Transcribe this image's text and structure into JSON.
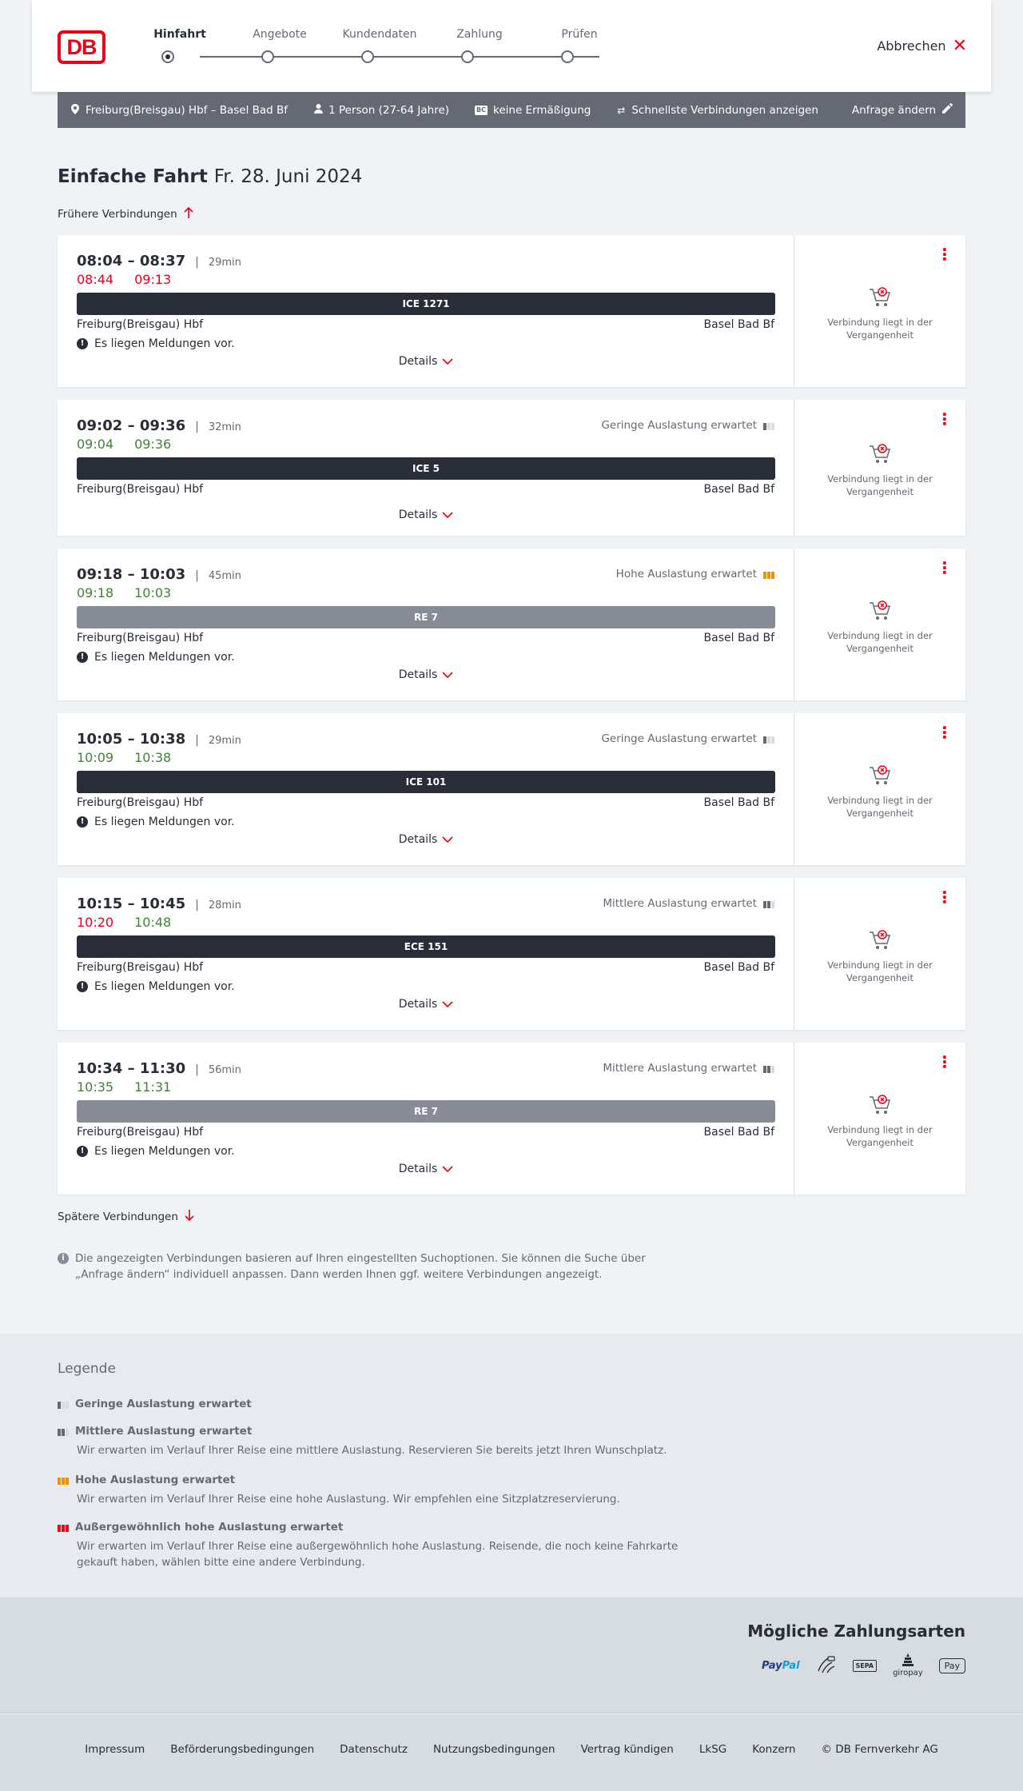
{
  "header": {
    "logo": "DB",
    "steps": [
      "Hinfahrt",
      "Angebote",
      "Kundendaten",
      "Zahlung",
      "Prüfen"
    ],
    "active_step": 0,
    "cancel_label": "Abbrechen"
  },
  "search": {
    "route": "Freiburg(Breisgau) Hbf – Basel Bad Bf",
    "passengers": "1 Person (27-64 Jahre)",
    "bahncard_badge": "BC",
    "discount": "keine Ermäßigung",
    "fastest": "Schnellste Verbindungen anzeigen",
    "change_label": "Anfrage ändern"
  },
  "page": {
    "title": "Einfache Fahrt",
    "date": "Fr. 28. Juni 2024",
    "earlier_label": "Frühere Verbindungen",
    "later_label": "Spätere Verbindungen",
    "info_text": "Die angezeigten Verbindungen basieren auf Ihren eingestellten Suchoptionen. Sie können die Suche über „Anfrage ändern“ individuell anpassen. Dann werden Ihnen ggf. weitere Verbindungen angezeigt."
  },
  "connections": [
    {
      "time": "08:04 – 08:37",
      "duration": "29min",
      "rt_dep": "08:44",
      "rt_arr": "09:13",
      "rt_dep_status": "late",
      "rt_arr_status": "late",
      "load_label": "",
      "load_level": 0,
      "train": "ICE 1271",
      "train_style": "dark",
      "from": "Freiburg(Breisgau) Hbf",
      "to": "Basel Bad Bf",
      "notice": "Es liegen Meldungen vor.",
      "details": "Details",
      "side_text": "Verbindung liegt in der Vergangenheit"
    },
    {
      "time": "09:02 – 09:36",
      "duration": "32min",
      "rt_dep": "09:04",
      "rt_arr": "09:36",
      "rt_dep_status": "ok",
      "rt_arr_status": "ok",
      "load_label": "Geringe Auslastung erwartet",
      "load_level": 1,
      "train": "ICE 5",
      "train_style": "dark",
      "from": "Freiburg(Breisgau) Hbf",
      "to": "Basel Bad Bf",
      "notice": "",
      "details": "Details",
      "side_text": "Verbindung liegt in der Vergangenheit"
    },
    {
      "time": "09:18 – 10:03",
      "duration": "45min",
      "rt_dep": "09:18",
      "rt_arr": "10:03",
      "rt_dep_status": "ok",
      "rt_arr_status": "ok",
      "load_label": "Hohe Auslastung erwartet",
      "load_level": 3,
      "train": "RE 7",
      "train_style": "grey",
      "from": "Freiburg(Breisgau) Hbf",
      "to": "Basel Bad Bf",
      "notice": "Es liegen Meldungen vor.",
      "details": "Details",
      "side_text": "Verbindung liegt in der Vergangenheit"
    },
    {
      "time": "10:05 – 10:38",
      "duration": "29min",
      "rt_dep": "10:09",
      "rt_arr": "10:38",
      "rt_dep_status": "ok",
      "rt_arr_status": "ok",
      "load_label": "Geringe Auslastung erwartet",
      "load_level": 1,
      "train": "ICE 101",
      "train_style": "dark",
      "from": "Freiburg(Breisgau) Hbf",
      "to": "Basel Bad Bf",
      "notice": "Es liegen Meldungen vor.",
      "details": "Details",
      "side_text": "Verbindung liegt in der Vergangenheit"
    },
    {
      "time": "10:15 – 10:45",
      "duration": "28min",
      "rt_dep": "10:20",
      "rt_arr": "10:48",
      "rt_dep_status": "late",
      "rt_arr_status": "ok",
      "load_label": "Mittlere Auslastung erwartet",
      "load_level": 2,
      "train": "ECE 151",
      "train_style": "dark",
      "from": "Freiburg(Breisgau) Hbf",
      "to": "Basel Bad Bf",
      "notice": "Es liegen Meldungen vor.",
      "details": "Details",
      "side_text": "Verbindung liegt in der Vergangenheit"
    },
    {
      "time": "10:34 – 11:30",
      "duration": "56min",
      "rt_dep": "10:35",
      "rt_arr": "11:31",
      "rt_dep_status": "ok",
      "rt_arr_status": "ok",
      "load_label": "Mittlere Auslastung erwartet",
      "load_level": 2,
      "train": "RE 7",
      "train_style": "grey",
      "from": "Freiburg(Breisgau) Hbf",
      "to": "Basel Bad Bf",
      "notice": "Es liegen Meldungen vor.",
      "details": "Details",
      "side_text": "Verbindung liegt in der Vergangenheit"
    }
  ],
  "legend": {
    "title": "Legende",
    "items": [
      {
        "level": 1,
        "title": "Geringe Auslastung erwartet",
        "desc": ""
      },
      {
        "level": 2,
        "title": "Mittlere Auslastung erwartet",
        "desc": "Wir erwarten im Verlauf Ihrer Reise eine mittlere Auslastung. Reservieren Sie bereits jetzt Ihren Wunschplatz."
      },
      {
        "level": 3,
        "title": "Hohe Auslastung erwartet",
        "desc": "Wir erwarten im Verlauf Ihrer Reise eine hohe Auslastung. Wir empfehlen eine Sitzplatzreservierung."
      },
      {
        "level": 4,
        "title": "Außergewöhnlich hohe Auslastung erwartet",
        "desc": "Wir erwarten im Verlauf Ihrer Reise eine außergewöhnlich hohe Auslastung. Reisende, die noch keine Fahrkarte gekauft haben, wählen bitte eine andere Verbindung."
      }
    ]
  },
  "payment": {
    "title": "Mögliche Zahlungsarten",
    "methods": {
      "paypal_a": "Pay",
      "paypal_b": "Pal",
      "sepa": "SEPA",
      "giropay": "giropay",
      "applepay": "Pay"
    }
  },
  "footer": {
    "links": [
      "Impressum",
      "Beförderungsbedingungen",
      "Datenschutz",
      "Nutzungsbedingungen",
      "Vertrag kündigen",
      "LkSG",
      "Konzern",
      "© DB Fernverkehr AG"
    ]
  },
  "colors": {
    "brand_red": "#ec0016",
    "on_time_green": "#408335",
    "high_load_orange": "#f39200",
    "dark_train": "#282d37",
    "grey_train": "#878c96"
  }
}
